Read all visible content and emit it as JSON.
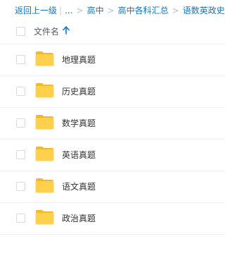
{
  "breadcrumb": {
    "back": "返回上一级",
    "ellipsis": "...",
    "items": [
      "高中",
      "高中各科汇总",
      "语数英政史地"
    ]
  },
  "list": {
    "column_name": "文件名",
    "sort": "ascending",
    "items": [
      {
        "name": "地理真题",
        "icon": "folder-icon"
      },
      {
        "name": "历史真题",
        "icon": "folder-icon"
      },
      {
        "name": "数学真题",
        "icon": "folder-icon"
      },
      {
        "name": "英语真题",
        "icon": "folder-icon"
      },
      {
        "name": "语文真题",
        "icon": "folder-icon"
      },
      {
        "name": "政治真题",
        "icon": "folder-icon"
      }
    ]
  },
  "colors": {
    "link": "#0b78d4",
    "folder": "#ffd04b",
    "folder_back": "#f5b829"
  }
}
